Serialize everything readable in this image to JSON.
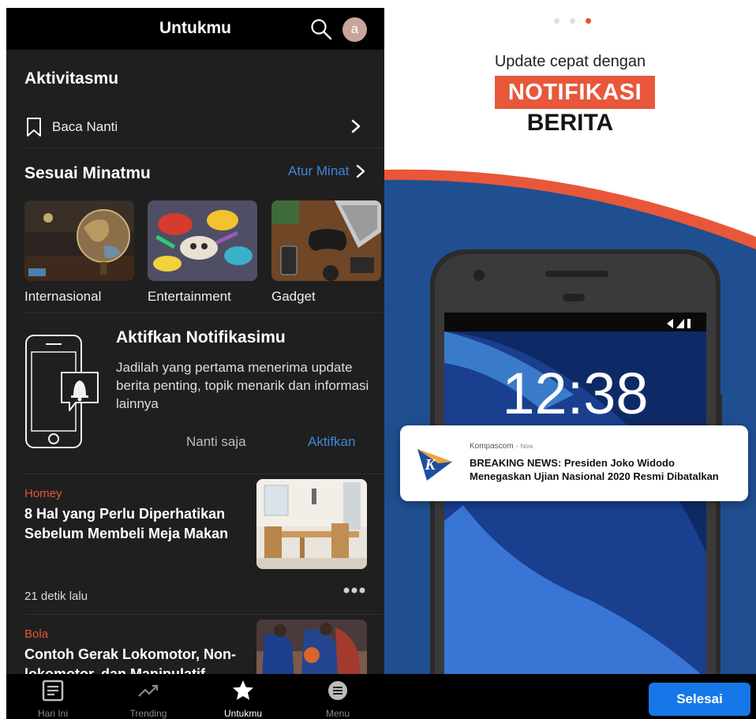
{
  "left": {
    "header": {
      "title": "Untukmu",
      "avatar_letter": "a"
    },
    "activity": {
      "title": "Aktivitasmu",
      "read_later": "Baca Nanti"
    },
    "interests": {
      "title": "Sesuai Minatmu",
      "manage_label": "Atur Minat",
      "topics": [
        {
          "label": "Internasional"
        },
        {
          "label": "Entertainment"
        },
        {
          "label": "Gadget"
        }
      ]
    },
    "notification_card": {
      "title": "Aktifkan Notifikasimu",
      "body": "Jadilah yang pertama menerima update berita penting, topik menarik dan informasi lainnya",
      "later_label": "Nanti saja",
      "enable_label": "Aktifkan"
    },
    "articles": [
      {
        "category": "Homey",
        "headline": "8 Hal yang Perlu Diperhatikan Sebelum Membeli Meja Makan",
        "time": "21 detik lalu"
      },
      {
        "category": "Bola",
        "headline": "Contoh Gerak Lokomotor, Non-lokomotor, dan Manipulatif dalam",
        "time": ""
      }
    ],
    "bottom_nav": [
      {
        "label": "Hari Ini",
        "icon": "newspaper-icon"
      },
      {
        "label": "Trending",
        "icon": "trending-icon"
      },
      {
        "label": "Untukmu",
        "icon": "star-icon",
        "active": true
      },
      {
        "label": "Menu",
        "icon": "menu-icon"
      }
    ]
  },
  "right": {
    "pager": {
      "total": 3,
      "active_index": 2
    },
    "promo": {
      "line1": "Update cepat dengan",
      "highlight": "NOTIFIKASI",
      "line3": "BERITA"
    },
    "phone": {
      "clock": "12:38"
    },
    "notification": {
      "source": "Kompascom",
      "ago": "Now",
      "text": "BREAKING NEWS: Presiden Joko Widodo Menegaskan Ujian Nasional 2020 Resmi Dibatalkan",
      "logo_letter": "K"
    },
    "done_label": "Selesai"
  },
  "colors": {
    "accent_blue": "#3f86d8",
    "accent_orange": "#e8573a",
    "done_blue": "#1677e8",
    "category_red": "#e8533d",
    "dark_bg": "#1f1f1f"
  }
}
